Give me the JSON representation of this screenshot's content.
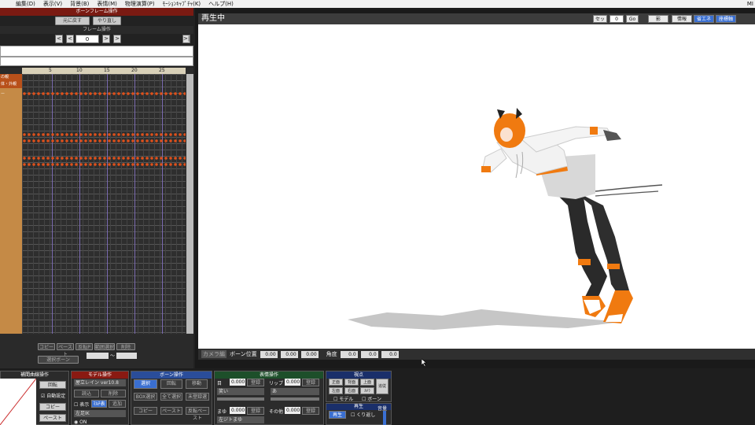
{
  "menu": [
    "",
    "編集(D)",
    "表示(V)",
    "背景(B)",
    "表情(M)",
    "物理演算(P)",
    "ﾓｰｼｮﾝｷｬﾌﾟﾁｬ(K)",
    "ヘルプ(H)"
  ],
  "menu_right": "MI",
  "bone_frame": {
    "title": "ボーンフレーム操作",
    "btn1": "元に戻す",
    "btn2": "やり直し"
  },
  "frame_op": {
    "title": "フレーム操作",
    "prev2": "<",
    "prev1": "<",
    "value": "0",
    "next1": ">",
    "next2": ">",
    "end": ">|"
  },
  "timeline": {
    "ticks": [
      "5",
      "10",
      "15",
      "20",
      "25"
    ],
    "labels": [
      "の親",
      "体・外親",
      "ー",
      "",
      "",
      ""
    ]
  },
  "bottom_tl": {
    "btn_copy": "コピー",
    "btn_paste": "ペースト",
    "btn_reverse": "反転P",
    "btn_range": "範囲選択",
    "btn_delete": "削除",
    "select_label": "選択ボーン",
    "tilde": "〜"
  },
  "viewport": {
    "title": "再生中",
    "set_label": "セット",
    "set_value": "0",
    "go": "Go",
    "shadow": "影",
    "info": "情報",
    "btn_blue1": "省エネ",
    "btn_blue2": "座標軸",
    "camera_label": "カメラ編",
    "bone_pos": "ボーン位置",
    "angle": "角度",
    "pos_values": [
      "0.00",
      "0.00",
      "0.00"
    ],
    "angle_values": [
      "0.0",
      "0.0",
      "0.0"
    ]
  },
  "panels": {
    "interp": {
      "title": "補間曲線操作",
      "rot": "回転",
      "auto": "自動設定",
      "copy": "コピー",
      "paste": "ペースト"
    },
    "model": {
      "title": "モデル操作",
      "model_name": "屋立レイン ver10.8",
      "load": "読込",
      "delete": "削除",
      "display": "表示",
      "toggle": "ﾏﾙﾁ表",
      "add": "追加",
      "leftfoot": "左足IK",
      "on": "ON"
    },
    "bone": {
      "title": "ボーン操作",
      "select": "選択",
      "rotate": "回転",
      "move": "移動",
      "box": "BOX選択",
      "all": "全て選択",
      "unreg": "未登録選",
      "copy": "コピー",
      "paste": "ペースト",
      "rev": "反転ペースト"
    },
    "face": {
      "title": "表情操作",
      "eye": "目",
      "eye_val": "0.000",
      "reg": "登録",
      "lip": "リップ",
      "lip_val": "0.000",
      "reg2": "登録",
      "eye_opt": "笑い",
      "lip_opt": "あ",
      "brow": "まゆ",
      "brow_val": "0.000",
      "reg3": "登録",
      "other": "その他",
      "other_val": "0.000",
      "reg4": "登録",
      "brow_opt": "左ジトまゆ"
    },
    "view": {
      "title": "視点",
      "front": "正面",
      "back": "背面",
      "top": "上面",
      "left": "左面",
      "right": "右面",
      "camera": "ｶﾒﾗ",
      "track": "追従",
      "model": "モデル",
      "bone": "ボーン"
    },
    "play": {
      "title": "再生",
      "play": "再生",
      "repeat": "くり返し",
      "volume": "音量"
    }
  }
}
